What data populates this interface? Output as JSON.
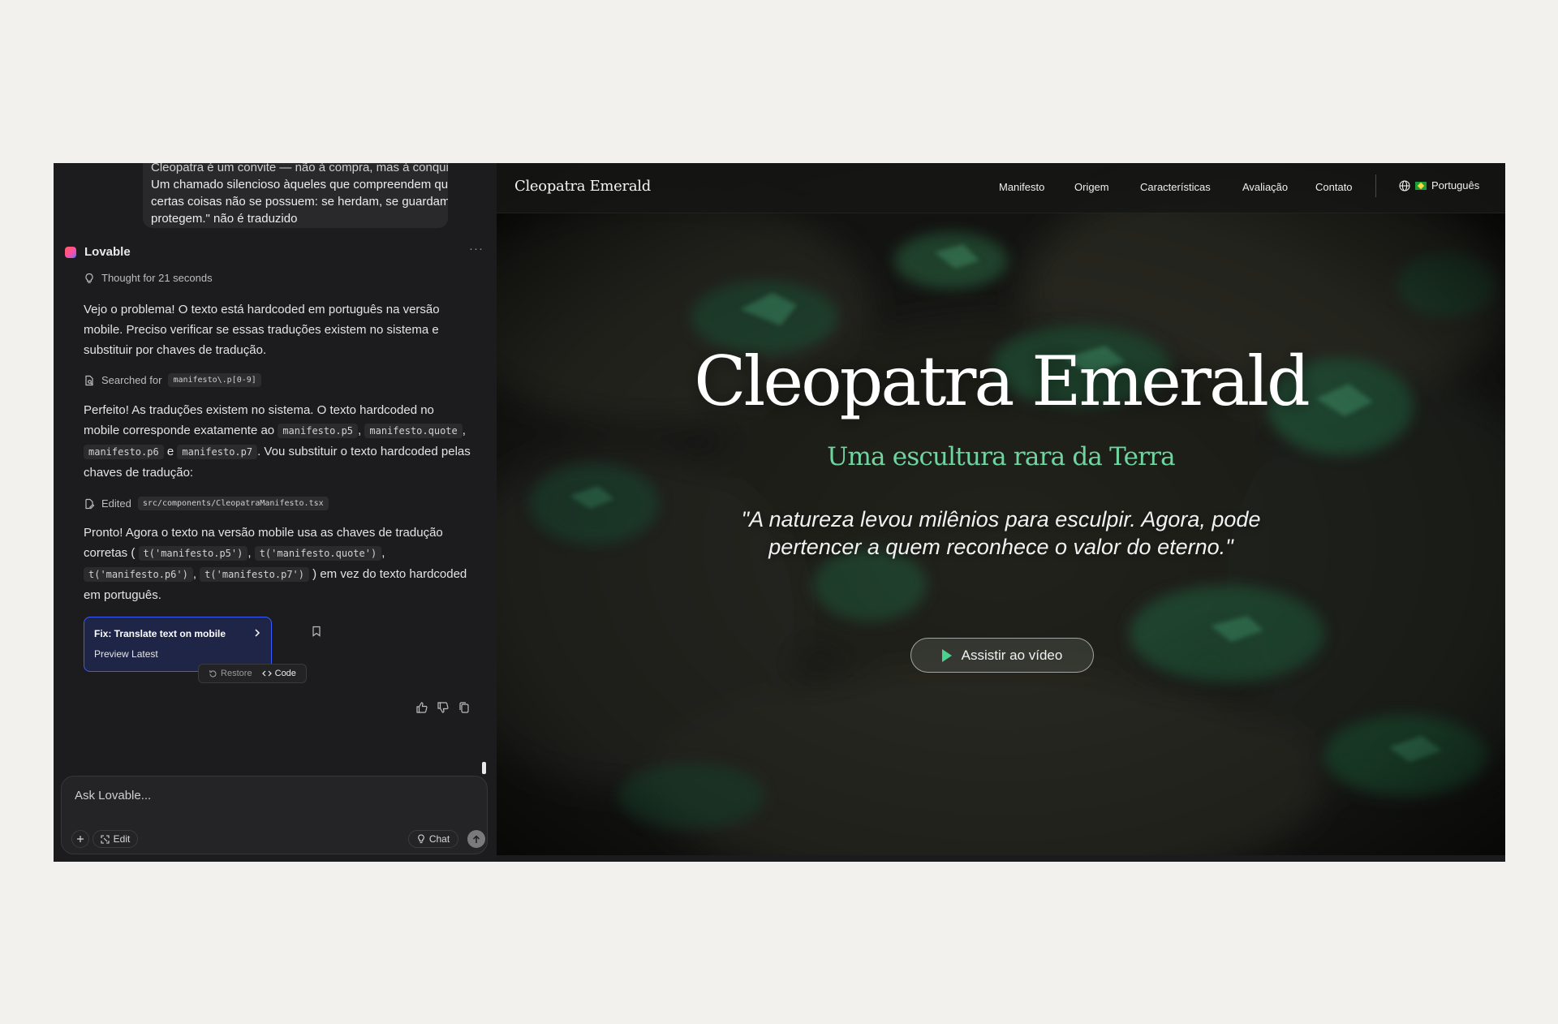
{
  "chat": {
    "user_message_lines": [
      "Cleopatra é um convite — não à compra, mas à conquista.",
      "Um chamado silencioso àqueles que compreendem que",
      "certas coisas não se possuem: se herdam, se guardam, se",
      "protegem.\" não é traduzido"
    ],
    "assistant_name": "Lovable",
    "more_label": "···",
    "thought_label": "Thought for 21 seconds",
    "msg1": "Vejo o problema! O texto está hardcoded em português na versão mobile. Preciso verificar se essas traduções existem no sistema e substituir por chaves de tradução.",
    "searched_label": "Searched for",
    "searched_query": "manifesto\\.p[0-9]",
    "msg2": {
      "intro": "Perfeito! As traduções existem no sistema. O texto hardcoded no mobile corresponde exatamente ao",
      "code1": "manifesto.p5",
      "sep1": ",",
      "code2": "manifesto.quote",
      "sep2": ",",
      "code3": "manifesto.p6",
      "and": "e",
      "code4": "manifesto.p7",
      "outro": ". Vou substituir o texto hardcoded pelas chaves de tradução:"
    },
    "edited_label": "Edited",
    "edited_file": "src/components/CleopatraManifesto.tsx",
    "msg3": {
      "intro": "Pronto! Agora o texto na versão mobile usa as chaves de tradução corretas (",
      "code1": "t('manifesto.p5')",
      "sep1": ",",
      "code2": "t('manifesto.quote')",
      "sep2": ",",
      "code3": "t('manifesto.p6')",
      "sep3": ",",
      "code4": "t('manifesto.p7')",
      "outro": ") em vez do texto hardcoded em português."
    },
    "fix_card": {
      "title": "Fix: Translate text on mobile",
      "subtitle": "Preview Latest"
    },
    "restore_label": "Restore",
    "code_label": "Code",
    "composer": {
      "placeholder": "Ask Lovable...",
      "edit_label": "Edit",
      "chat_label": "Chat"
    }
  },
  "preview": {
    "brand": "Cleopatra Emerald",
    "nav": [
      "Manifesto",
      "Origem",
      "Características",
      "Avaliação",
      "Contato"
    ],
    "language": "Português",
    "hero_title": "Cleopatra Emerald",
    "hero_subtitle": "Uma escultura rara da Terra",
    "hero_quote": "\"A natureza levou milênios para esculpir. Agora, pode pertencer a quem reconhece o valor do eterno.\"",
    "video_button": "Assistir ao vídeo"
  },
  "colors": {
    "accent_green": "#6fd4a0",
    "play_green": "#4bd18b",
    "card_blue_border": "#3a5cff",
    "panel_bg": "#1c1c1e",
    "page_bg": "#f2f1ed"
  }
}
